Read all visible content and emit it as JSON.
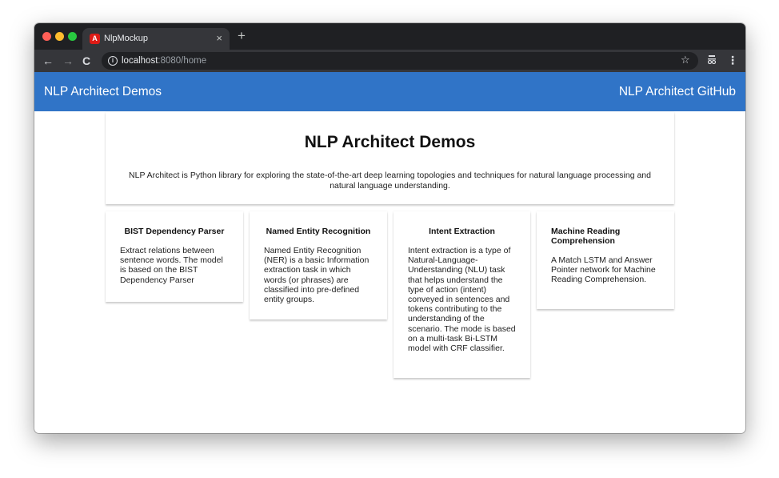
{
  "browser": {
    "tab": {
      "favicon": "A",
      "title": "NlpMockup",
      "close": "×"
    },
    "new_tab": "+",
    "nav": {
      "back": "←",
      "forward": "→",
      "reload": "C"
    },
    "url": {
      "host": "localhost",
      "path": ":8080/home"
    },
    "star": "☆",
    "menu": "⋮"
  },
  "header": {
    "title": "NLP Architect Demos",
    "github_link": "NLP Architect GitHub",
    "color": "#3074c7"
  },
  "hero": {
    "title": "NLP Architect Demos",
    "description": "NLP Architect is Python library for exploring the state-of-the-art deep learning topologies and techniques for natural language processing and natural language understanding."
  },
  "cards": [
    {
      "title": "BIST Dependency Parser",
      "description": "Extract relations between sentence words. The model is based on the BIST Dependency Parser"
    },
    {
      "title": "Named Entity Recognition",
      "description": "Named Entity Recognition (NER) is a basic Information extraction task in which words (or phrases) are classified into pre-defined entity groups."
    },
    {
      "title": "Intent Extraction",
      "description": "Intent extraction is a type of Natural-Language-Understanding (NLU) task that helps understand the type of action (intent) conveyed in sentences and tokens contributing to the understanding of the scenario. The mode is based on a multi-task Bi-LSTM model with CRF classifier."
    },
    {
      "title": "Machine Reading Comprehension",
      "description": "A Match LSTM and Answer Pointer network for Machine Reading Comprehension."
    }
  ]
}
